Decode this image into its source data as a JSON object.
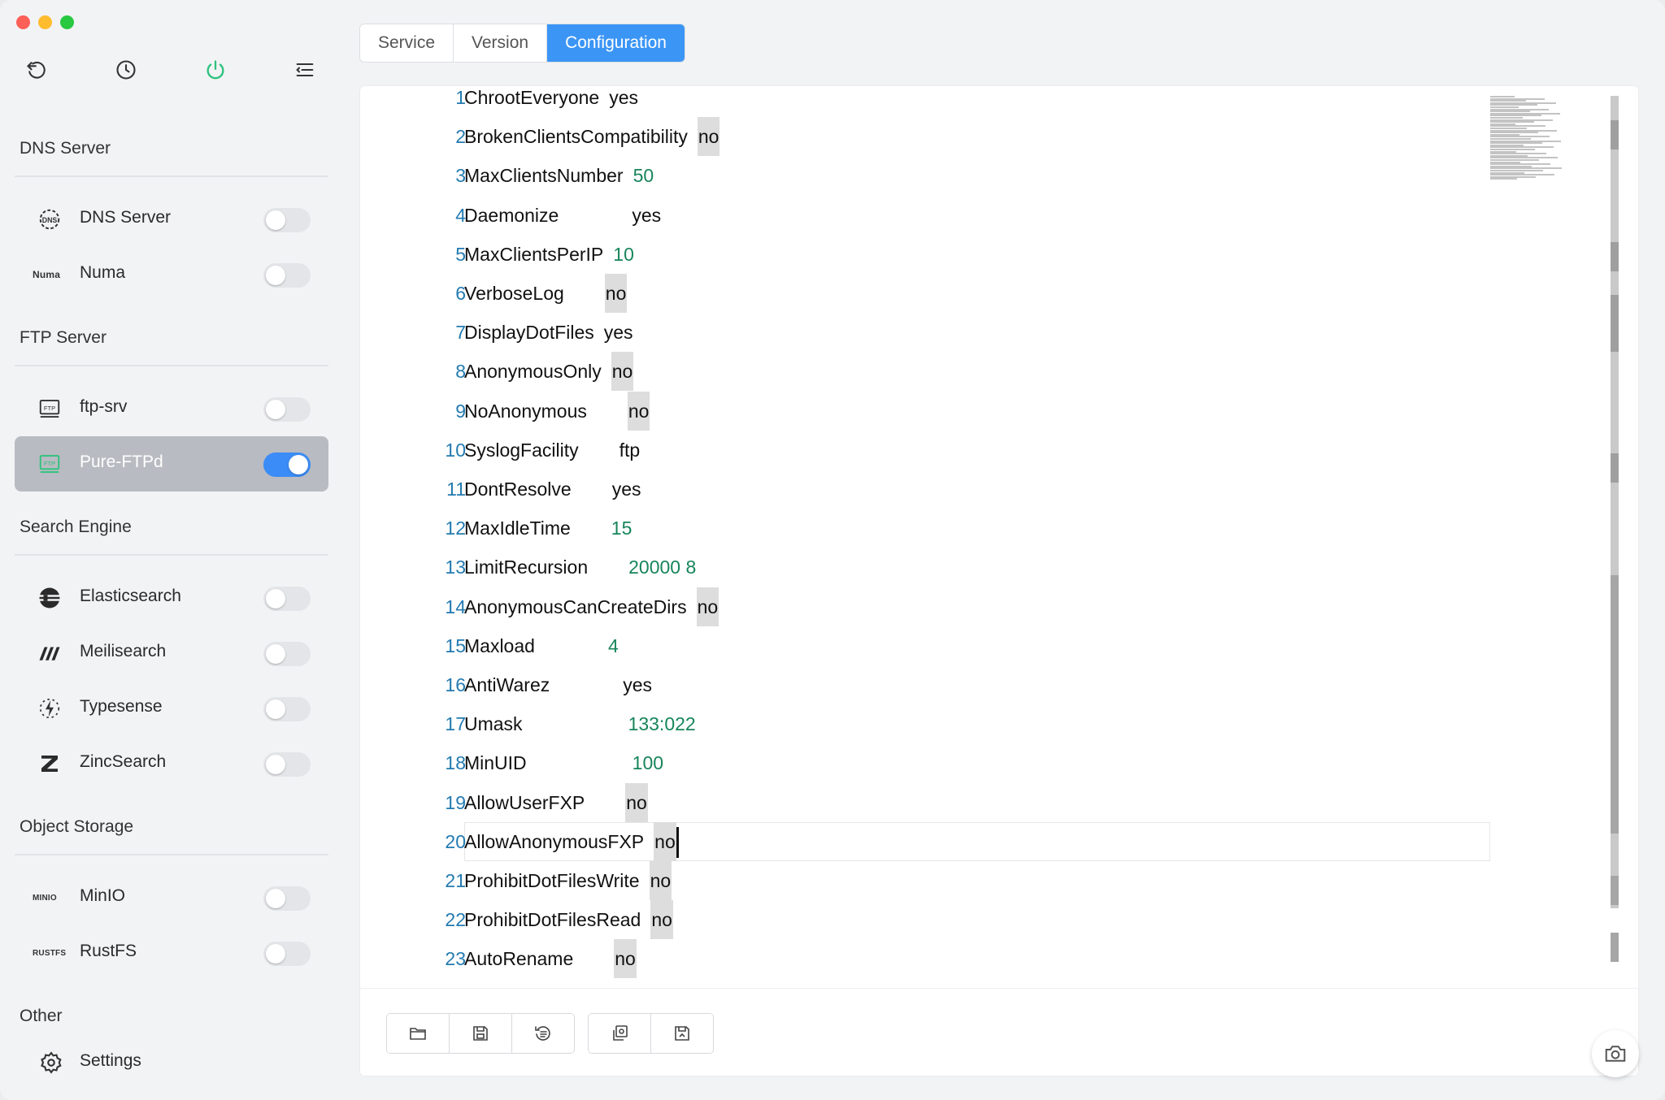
{
  "sidebar": {
    "groups": [
      {
        "title": "DNS Server",
        "items": [
          {
            "icon": "dns-icon",
            "tag": "",
            "label": "DNS Server",
            "on": false
          },
          {
            "icon": "numa-logo",
            "tag": "Numa",
            "label": "Numa",
            "on": false
          }
        ]
      },
      {
        "title": "FTP Server",
        "items": [
          {
            "icon": "ftp-icon",
            "tag": "",
            "label": "ftp-srv",
            "on": false
          },
          {
            "icon": "ftp-icon",
            "tag": "",
            "label": "Pure-FTPd",
            "on": true,
            "active": true
          }
        ]
      },
      {
        "title": "Search Engine",
        "items": [
          {
            "icon": "elasticsearch-icon",
            "tag": "",
            "label": "Elasticsearch",
            "on": false
          },
          {
            "icon": "meilisearch-icon",
            "tag": "",
            "label": "Meilisearch",
            "on": false
          },
          {
            "icon": "typesense-icon",
            "tag": "",
            "label": "Typesense",
            "on": false
          },
          {
            "icon": "zincsearch-icon",
            "tag": "",
            "label": "ZincSearch",
            "on": false
          }
        ]
      },
      {
        "title": "Object Storage",
        "items": [
          {
            "icon": "minio-logo",
            "tag": "MINIO",
            "label": "MinIO",
            "on": false
          },
          {
            "icon": "rustfs-logo",
            "tag": "RUSTFS",
            "label": "RustFS",
            "on": false
          }
        ]
      },
      {
        "title": "Other",
        "items": [
          {
            "icon": "gear-icon",
            "tag": "",
            "label": "Settings"
          }
        ]
      }
    ]
  },
  "tabs": {
    "service": "Service",
    "version": "Version",
    "configuration": "Configuration",
    "active": "Configuration"
  },
  "editor": {
    "lines": [
      {
        "n": "1",
        "key": "ChrootEveryone",
        "value": "yes",
        "type": "str"
      },
      {
        "n": "2",
        "key": "BrokenClientsCompatibility",
        "value": "no",
        "type": "hl"
      },
      {
        "n": "3",
        "key": "MaxClientsNumber",
        "value": "50",
        "type": "num"
      },
      {
        "n": "4",
        "key": "Daemonize",
        "value": "yes",
        "type": "str"
      },
      {
        "n": "5",
        "key": "MaxClientsPerIP",
        "value": "10",
        "type": "num"
      },
      {
        "n": "6",
        "key": "VerboseLog",
        "value": "no",
        "type": "hl"
      },
      {
        "n": "7",
        "key": "DisplayDotFiles",
        "value": "yes",
        "type": "str"
      },
      {
        "n": "8",
        "key": "AnonymousOnly",
        "value": "no",
        "type": "hl"
      },
      {
        "n": "9",
        "key": "NoAnonymous",
        "value": "no",
        "type": "hl"
      },
      {
        "n": "10",
        "key": "SyslogFacility",
        "value": "ftp",
        "type": "str"
      },
      {
        "n": "11",
        "key": "DontResolve",
        "value": "yes",
        "type": "str"
      },
      {
        "n": "12",
        "key": "MaxIdleTime",
        "value": "15",
        "type": "num"
      },
      {
        "n": "13",
        "key": "LimitRecursion",
        "value": "20000 8",
        "type": "num"
      },
      {
        "n": "14",
        "key": "AnonymousCanCreateDirs",
        "value": "no",
        "type": "hl"
      },
      {
        "n": "15",
        "key": "Maxload",
        "value": "4",
        "type": "num"
      },
      {
        "n": "16",
        "key": "AntiWarez",
        "value": "yes",
        "type": "str"
      },
      {
        "n": "17",
        "key": "Umask",
        "value": "133:022",
        "type": "num"
      },
      {
        "n": "18",
        "key": "MinUID",
        "value": "100",
        "type": "num"
      },
      {
        "n": "19",
        "key": "AllowUserFXP",
        "value": "no",
        "type": "hl"
      },
      {
        "n": "20",
        "key": "AllowAnonymousFXP",
        "value": "no",
        "type": "hl",
        "current": true
      },
      {
        "n": "21",
        "key": "ProhibitDotFilesWrite",
        "value": "no",
        "type": "hl"
      },
      {
        "n": "22",
        "key": "ProhibitDotFilesRead",
        "value": "no",
        "type": "hl"
      },
      {
        "n": "23",
        "key": "AutoRename",
        "value": "no",
        "type": "hl"
      }
    ]
  },
  "toolbar_icons": [
    "back-icon",
    "history-icon",
    "power-icon",
    "menu-icon"
  ],
  "bottom_actions": [
    "open-folder-icon",
    "save-icon",
    "reset-icon",
    "copy-icon",
    "save-as-icon"
  ],
  "colors": {
    "accent": "#3b95f5",
    "toggle_on": "#3b8cf6",
    "power": "#2ec27e",
    "number": "#17855b",
    "line_number": "#237bb1"
  }
}
